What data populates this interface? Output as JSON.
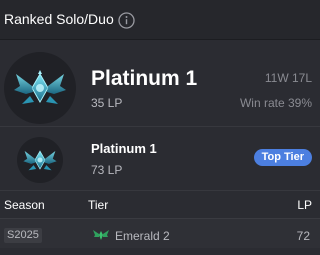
{
  "header": {
    "title": "Ranked Solo/Duo",
    "info_icon": "info-circle-icon"
  },
  "current_rank": {
    "emblem_icon": "platinum-emblem-icon",
    "tier": "Platinum 1",
    "lp": "35 LP",
    "record": "11W 17L",
    "win_rate": "Win rate 39%"
  },
  "peak_rank": {
    "emblem_icon": "platinum-emblem-icon",
    "tier": "Platinum 1",
    "lp": "73 LP",
    "badge": "Top Tier"
  },
  "season_table": {
    "columns": [
      "Season",
      "Tier",
      "LP"
    ],
    "rows": [
      {
        "season": "S2025",
        "tier_icon": "emerald-emblem-icon",
        "tier": "Emerald 2",
        "lp": "72"
      }
    ]
  },
  "colors": {
    "background": "#2b2c32",
    "header_bg": "#26272c",
    "badge_blue": "#4c7fe0",
    "platinum_accent": "#3fc3e0",
    "emerald_accent": "#2fa25e"
  }
}
